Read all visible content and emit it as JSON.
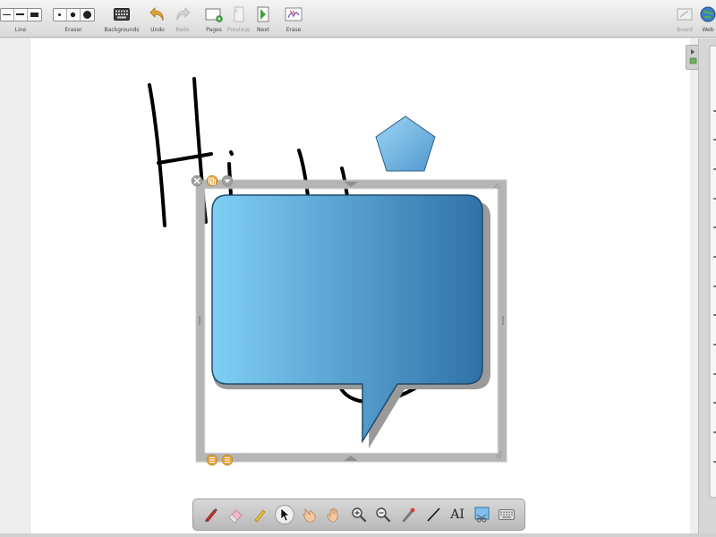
{
  "toolbar": {
    "line_label": "Line",
    "eraser_label": "Eraser",
    "backgrounds_label": "Backgrounds",
    "undo_label": "Undo",
    "redo_label": "Redo",
    "pages_label": "Pages",
    "previous_label": "Previous",
    "next_label": "Next",
    "erase_label": "Erase",
    "board_label": "Board",
    "web_label": "Web"
  },
  "bottom_toolbar": {
    "text_tool_label": "AI"
  },
  "colors": {
    "shape_fill_light": "#7fcff5",
    "shape_fill_dark": "#2f72a8",
    "shape_outline": "#1f4a6e",
    "selection_frame": "#b5b5b5",
    "ink": "#000000"
  }
}
